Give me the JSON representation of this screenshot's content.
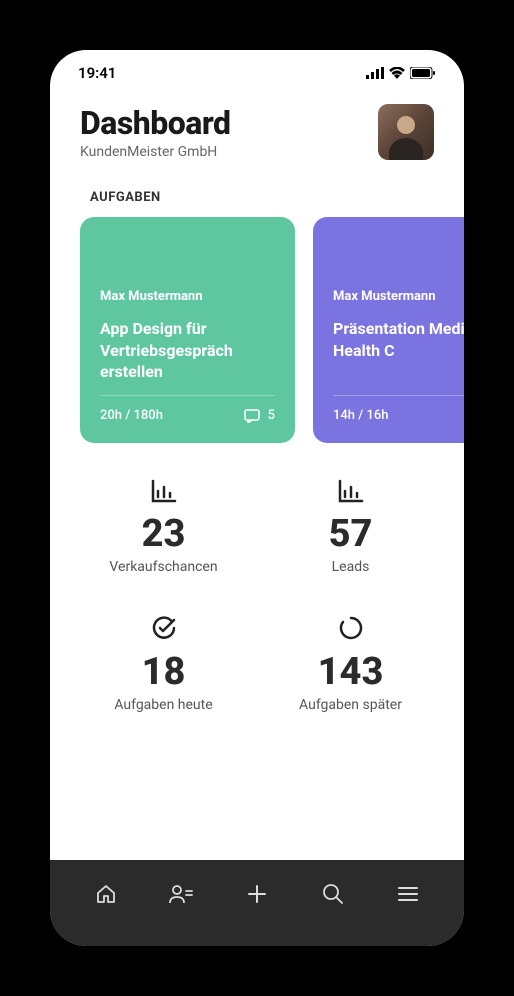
{
  "status": {
    "time": "19:41"
  },
  "header": {
    "title": "Dashboard",
    "subtitle": "KundenMeister GmbH"
  },
  "section_label": "AUFGABEN",
  "cards": [
    {
      "owner": "Max Mustermann",
      "title": "App Design für Vertriebsgespräch erstellen",
      "hours": "20h / 180h",
      "comments": "5",
      "color": "green"
    },
    {
      "owner": "Max Mustermann",
      "title": "Präsentation Medical Health C",
      "hours": "14h / 16h",
      "comments": "",
      "color": "purple"
    }
  ],
  "stats": [
    {
      "icon": "bar-chart",
      "value": "23",
      "label": "Verkaufschancen"
    },
    {
      "icon": "bar-chart",
      "value": "57",
      "label": "Leads"
    },
    {
      "icon": "check-circle",
      "value": "18",
      "label": "Aufgaben heute"
    },
    {
      "icon": "progress",
      "value": "143",
      "label": "Aufgaben später"
    }
  ],
  "nav": {
    "home": "home-icon",
    "contacts": "contacts-icon",
    "add": "plus-icon",
    "search": "search-icon",
    "menu": "menu-icon"
  }
}
